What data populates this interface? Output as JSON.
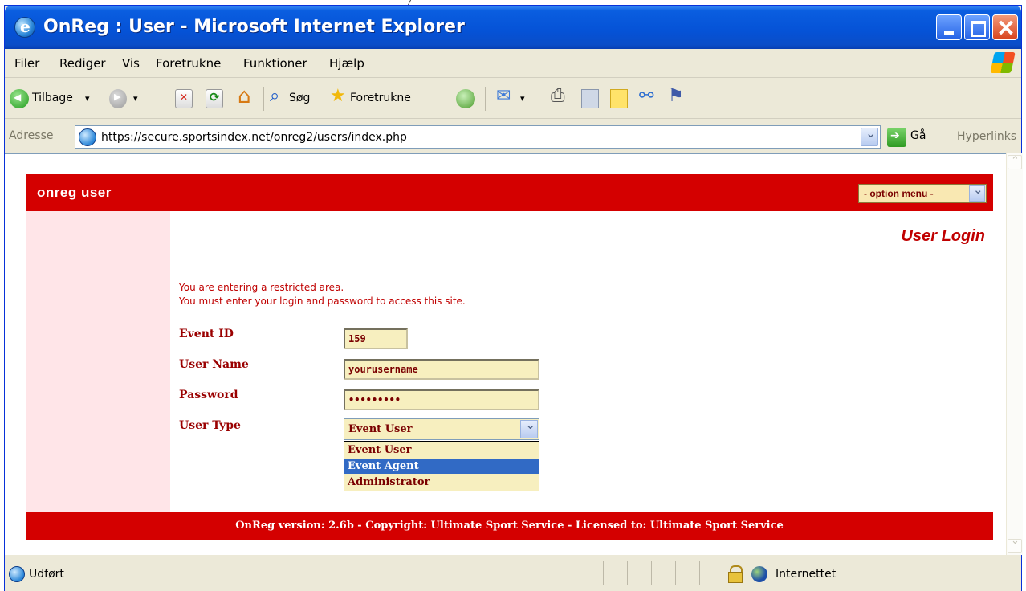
{
  "window": {
    "title": "OnReg : User - Microsoft Internet Explorer",
    "top_fragment": "/"
  },
  "menu": [
    "Filer",
    "Rediger",
    "Vis",
    "Foretrukne",
    "Funktioner",
    "Hjælp"
  ],
  "toolbar": {
    "back_label": "Tilbage",
    "search_label": "Søg",
    "favorites_label": "Foretrukne"
  },
  "address": {
    "label": "Adresse",
    "url": "https://secure.sportsindex.net/onreg2/users/index.php",
    "go_label": "Gå",
    "links_label": "Hyperlinks"
  },
  "page": {
    "brand": "onreg user",
    "option_menu": "- option menu -",
    "login_title": "User Login",
    "message_line1": "You are entering a restricted area.",
    "message_line2": "You must enter your login and password to access this site.",
    "fields": {
      "event_id": {
        "label": "Event ID",
        "value": "159"
      },
      "user_name": {
        "label": "User Name",
        "value": "yourusername"
      },
      "password": {
        "label": "Password",
        "value": "•••••••••"
      },
      "user_type": {
        "label": "User Type",
        "value": "Event User",
        "options": [
          "Event User",
          "Event Agent",
          "Administrator"
        ],
        "highlighted": "Event Agent"
      }
    },
    "footer": "OnReg version: 2.6b - Copyright: Ultimate Sport Service - Licensed to: Ultimate Sport Service"
  },
  "status": {
    "text": "Udført",
    "zone": "Internettet"
  },
  "colors": {
    "brand_red": "#d40000",
    "panel_pink": "#ffe5e8",
    "field_yellow": "#f7efbf",
    "xp_blue": "#0552d6"
  }
}
